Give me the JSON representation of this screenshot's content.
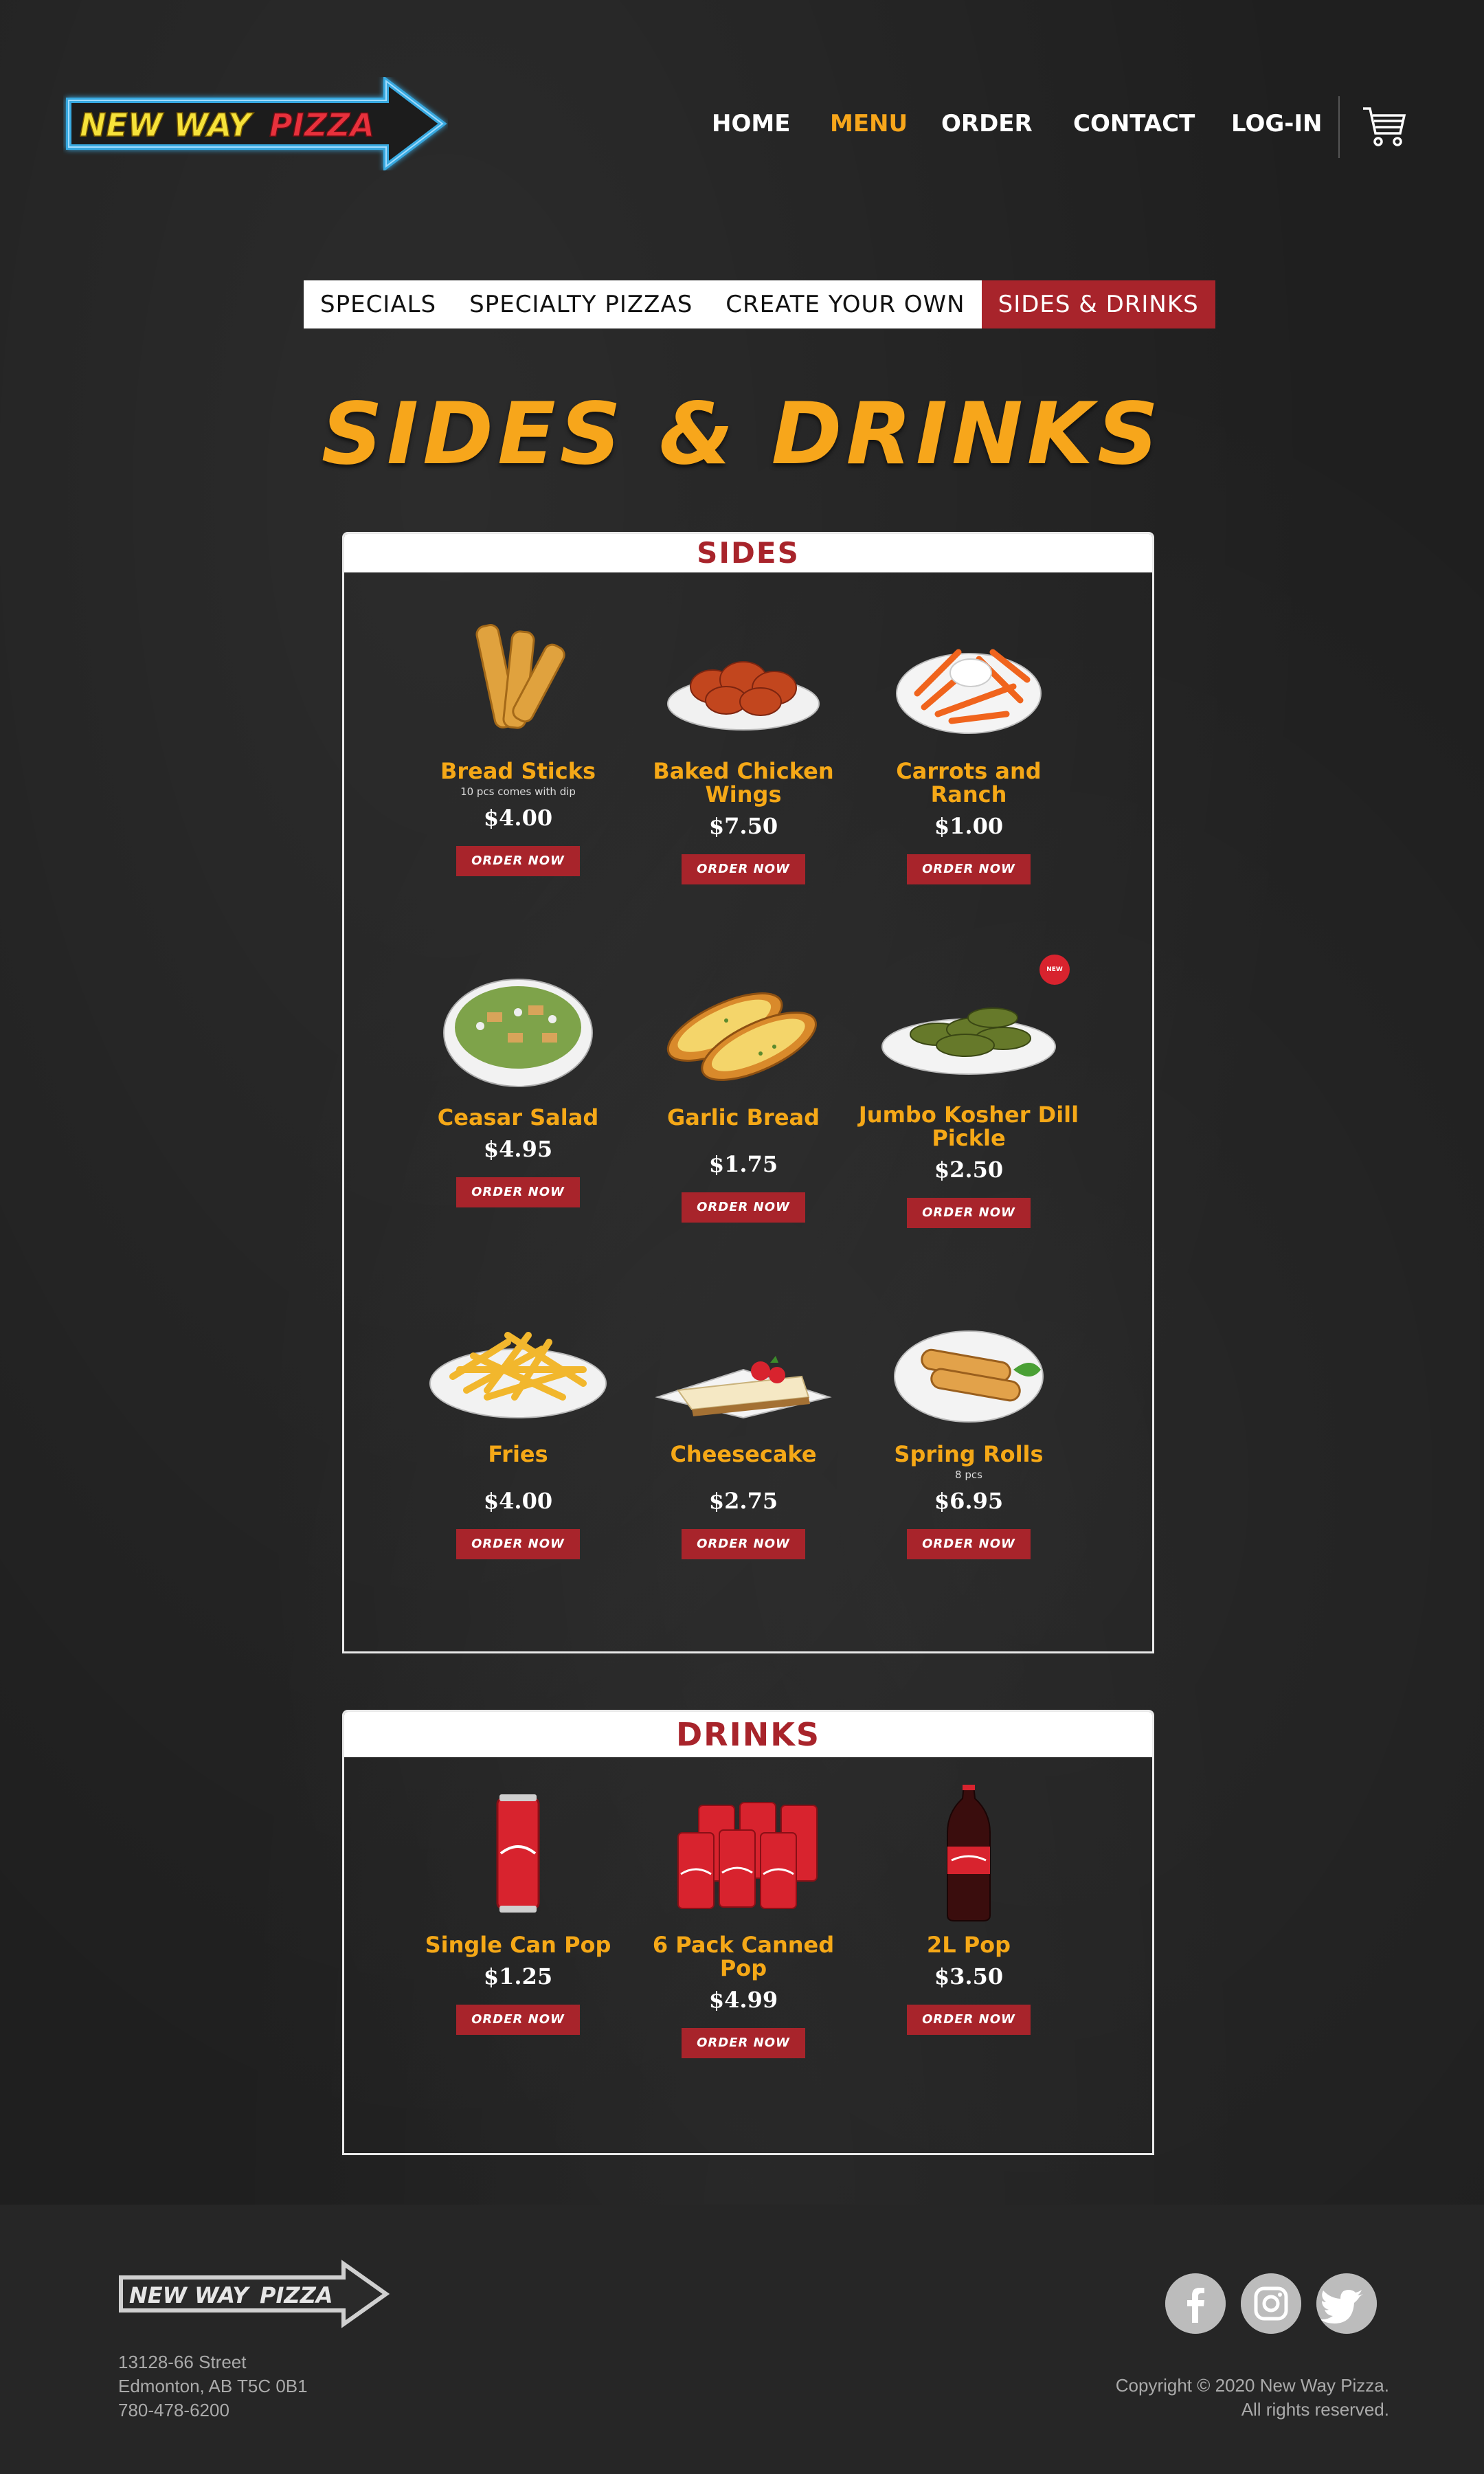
{
  "brand": {
    "logo_text_left": "NEW WAY",
    "logo_text_right": "PIZZA",
    "accent": "#f7a61b",
    "brand_red": "#a8242b"
  },
  "nav": {
    "home": "HOME",
    "menu": "MENU",
    "order": "ORDER",
    "contact": "CONTACT",
    "login": "LOG-IN",
    "active": "MENU",
    "cart_icon": "shopping-cart-icon"
  },
  "tabs": [
    "SPECIALS",
    "SPECIALTY PIZZAS",
    "CREATE YOUR OWN",
    "SIDES & DRINKS"
  ],
  "active_tab": "SIDES & DRINKS",
  "page_title": "SIDES & DRINKS",
  "sides": {
    "heading": "SIDES",
    "order_label": "ORDER NOW",
    "items": [
      {
        "name": "Bread Sticks",
        "note": "10 pcs comes with dip",
        "price": "$4.00"
      },
      {
        "name": "Baked Chicken Wings",
        "note": "",
        "price": "$7.50"
      },
      {
        "name": "Carrots and Ranch",
        "note": "",
        "price": "$1.00"
      },
      {
        "name": "Ceasar Salad",
        "note": "",
        "price": "$4.95"
      },
      {
        "name": "Garlic Bread",
        "note": "",
        "price": "$1.75"
      },
      {
        "name": "Jumbo Kosher Dill Pickle",
        "note": "",
        "price": "$2.50",
        "badge": "NEW"
      },
      {
        "name": "Fries",
        "note": "",
        "price": "$4.00"
      },
      {
        "name": "Cheesecake",
        "note": "",
        "price": "$2.75"
      },
      {
        "name": "Spring Rolls",
        "note": "8 pcs",
        "price": "$6.95"
      }
    ]
  },
  "drinks": {
    "heading": "DRINKS",
    "order_label": "ORDER NOW",
    "items": [
      {
        "name": "Single Can Pop",
        "price": "$1.25"
      },
      {
        "name": "6 Pack Canned Pop",
        "price": "$4.99"
      },
      {
        "name": "2L Pop",
        "price": "$3.50"
      }
    ]
  },
  "footer": {
    "address_line1": "13128-66 Street",
    "address_line2": "Edmonton, AB T5C 0B1",
    "phone": "780-478-6200",
    "copyright_line1": "Copyright © 2020 New Way Pizza.",
    "copyright_line2": "All rights reserved.",
    "social_icons": [
      "facebook-icon",
      "instagram-icon",
      "twitter-icon"
    ]
  }
}
